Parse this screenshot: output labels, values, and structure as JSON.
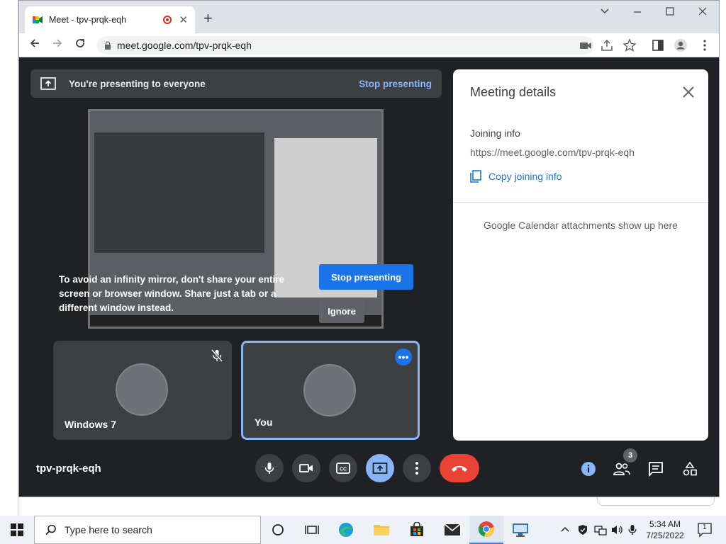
{
  "browser": {
    "tab_title": "Meet - tpv-prqk-eqh",
    "tab_close": "✕",
    "new_tab": "+",
    "url": "meet.google.com/tpv-prqk-eqh",
    "window_controls": {
      "minimize": "﹀",
      "maximize": "☐",
      "close": "✕"
    }
  },
  "presenting_bar": {
    "message": "You're presenting to everyone",
    "stop_link": "Stop presenting"
  },
  "warning": {
    "text": "To avoid an infinity mirror, don't share your entire screen or browser window. Share just a tab or a different window instead.",
    "stop_button": "Stop presenting",
    "ignore_button": "Ignore"
  },
  "tiles": [
    {
      "name": "Windows 7",
      "muted": true
    },
    {
      "name": "You",
      "muted": false
    }
  ],
  "details_panel": {
    "title": "Meeting details",
    "joining_label": "Joining info",
    "joining_url": "https://meet.google.com/tpv-prqk-eqh",
    "copy_label": "Copy joining info",
    "calendar_text": "Google Calendar attachments show up here"
  },
  "meeting_bar": {
    "code": "tpv-prqk-eqh",
    "participants_count": "3"
  },
  "taskbar": {
    "search_placeholder": "Type here to search",
    "time": "5:34 AM",
    "date": "7/25/2022",
    "notification_count": "1"
  },
  "colors": {
    "meet_bg": "#202124",
    "accent_blue": "#1a73e8",
    "light_blue": "#8ab4f8",
    "leave_red": "#ea4335"
  }
}
